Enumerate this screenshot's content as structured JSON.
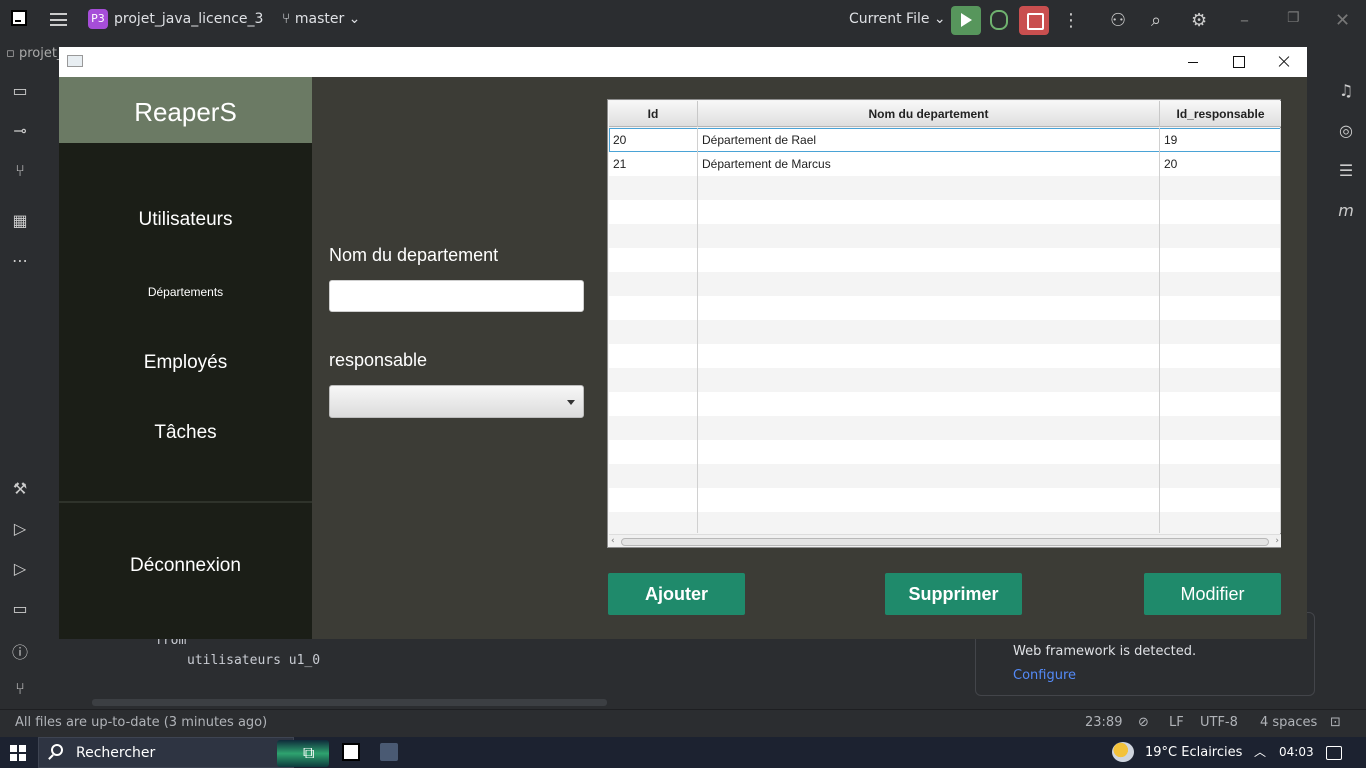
{
  "ide": {
    "logo_text": "IJ",
    "project_badge": "P3",
    "project_name": "projet_java_licence_3",
    "branch": "master",
    "run_config": "Current File",
    "open_tab": "projet_",
    "code_line_1": "from",
    "code_line_2": "utilisateurs u1_0",
    "notification_text": "Web framework is detected.",
    "notification_link": "Configure",
    "status_left": "All files are up-to-date (3 minutes ago)",
    "status_position": "23:89",
    "status_line_ending": "LF",
    "status_encoding": "UTF-8",
    "status_indent": "4 spaces"
  },
  "taskbar": {
    "search_placeholder": "Rechercher",
    "weather": "19°C  Eclaircies",
    "time": "04:03"
  },
  "app": {
    "brand": "ReaperS",
    "nav": {
      "users": "Utilisateurs",
      "departments": "Départements",
      "employees": "Employés",
      "tasks": "Tâches",
      "logout": "Déconnexion"
    },
    "form": {
      "name_label": "Nom du departement",
      "name_value": "",
      "manager_label": "responsable",
      "manager_value": ""
    },
    "table": {
      "columns": [
        "Id",
        "Nom du departement",
        "Id_responsable"
      ],
      "rows": [
        {
          "id": "20",
          "name": "Département de Rael",
          "manager_id": "19"
        },
        {
          "id": "21",
          "name": "Département de Marcus",
          "manager_id": "20"
        }
      ],
      "selected_row": 0
    },
    "buttons": {
      "add": "Ajouter",
      "delete": "Supprimer",
      "edit": "Modifier"
    }
  },
  "colors": {
    "brand_header": "#6b7a64",
    "sidebar_bg": "#1b1e17",
    "content_bg": "#3c3c36",
    "button": "#1f8a6b"
  }
}
